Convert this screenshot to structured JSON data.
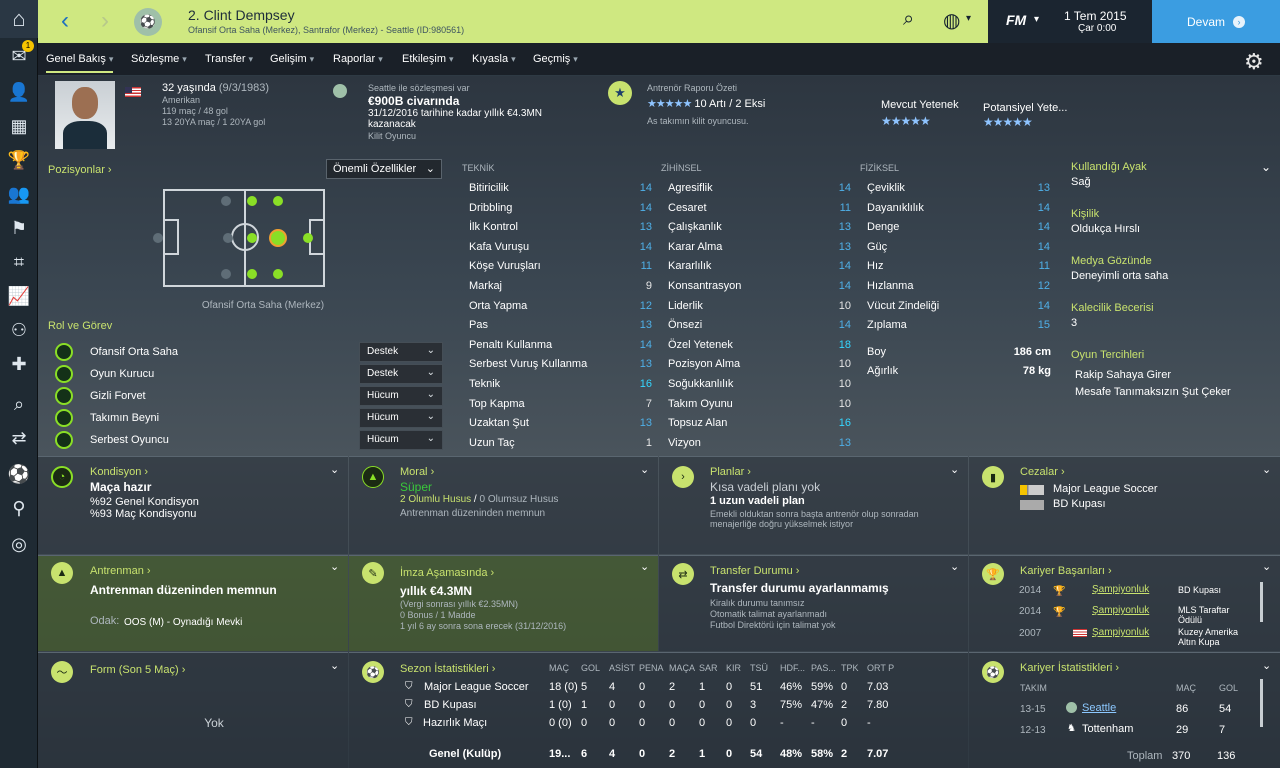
{
  "header": {
    "player_name": "2. Clint Dempsey",
    "player_sub": "Ofansif Orta Saha (Merkez), Santrafor (Merkez) - Seattle (ID:980561)",
    "date_line1": "1 Tem 2015",
    "date_line2": "Çar 0:00",
    "fm_logo": "FM",
    "continue_label": "Devam"
  },
  "sidebar": {
    "badge_count": "1"
  },
  "tabs": [
    {
      "label": "Genel Bakış"
    },
    {
      "label": "Sözleşme"
    },
    {
      "label": "Transfer"
    },
    {
      "label": "Gelişim"
    },
    {
      "label": "Raporlar"
    },
    {
      "label": "Etkileşim"
    },
    {
      "label": "Kıyasla"
    },
    {
      "label": "Geçmiş"
    }
  ],
  "profile": {
    "age": "32 yaşında",
    "dob": "(9/3/1983)",
    "nationality": "Amerikan",
    "club_apps": "119 maç / 48 gol",
    "intl_apps": "13 20YA maç / 1 20YA gol",
    "contract_label": "Seattle ile sözleşmesi var",
    "contract_wage": "€900B civarında",
    "contract_detail1": "31/12/2016 tarihine kadar yıllık €4.3MN",
    "contract_detail2": "kazanacak",
    "contract_role": "Kilit Oyuncu",
    "report_title": "Antrenör Raporu Özeti",
    "report_summary": "10 Artı / 2 Eksi",
    "report_note": "As takımın kilit oyuncusu.",
    "current_ability_label": "Mevcut Yetenek",
    "potential_ability_label": "Potansiyel Yete...",
    "current_ability_stars": 4.5,
    "potential_ability_stars": 4.5
  },
  "positions": {
    "title": "Pozisyonlar",
    "dropdown": "Önemli Özellikler",
    "caption": "Ofansif Orta Saha (Merkez)",
    "roles_title": "Rol ve Görev",
    "roles": [
      {
        "name": "Ofansif Orta Saha",
        "duty": "Destek"
      },
      {
        "name": "Oyun Kurucu",
        "duty": "Destek"
      },
      {
        "name": "Gizli Forvet",
        "duty": "Hücum"
      },
      {
        "name": "Takımın Beyni",
        "duty": "Hücum"
      },
      {
        "name": "Serbest Oyuncu",
        "duty": "Hücum"
      }
    ]
  },
  "attributes": {
    "technical_title": "TEKNİK",
    "mental_title": "ZİHİNSEL",
    "physical_title": "FİZİKSEL",
    "technical": [
      {
        "name": "Bitiricilik",
        "value": "14"
      },
      {
        "name": "Dribbling",
        "value": "14"
      },
      {
        "name": "İlk Kontrol",
        "value": "13"
      },
      {
        "name": "Kafa Vuruşu",
        "value": "14"
      },
      {
        "name": "Köşe Vuruşları",
        "value": "11"
      },
      {
        "name": "Markaj",
        "value": "9"
      },
      {
        "name": "Orta Yapma",
        "value": "12"
      },
      {
        "name": "Pas",
        "value": "13"
      },
      {
        "name": "Penaltı Kullanma",
        "value": "14"
      },
      {
        "name": "Serbest Vuruş Kullanma",
        "value": "13"
      },
      {
        "name": "Teknik",
        "value": "16"
      },
      {
        "name": "Top Kapma",
        "value": "7"
      },
      {
        "name": "Uzaktan Şut",
        "value": "13"
      },
      {
        "name": "Uzun Taç",
        "value": "1"
      }
    ],
    "mental": [
      {
        "name": "Agresiflik",
        "value": "14"
      },
      {
        "name": "Cesaret",
        "value": "11"
      },
      {
        "name": "Çalışkanlık",
        "value": "13"
      },
      {
        "name": "Karar Alma",
        "value": "13"
      },
      {
        "name": "Kararlılık",
        "value": "14"
      },
      {
        "name": "Konsantrasyon",
        "value": "14"
      },
      {
        "name": "Liderlik",
        "value": "10"
      },
      {
        "name": "Önsezi",
        "value": "14"
      },
      {
        "name": "Özel Yetenek",
        "value": "18"
      },
      {
        "name": "Pozisyon Alma",
        "value": "10"
      },
      {
        "name": "Soğukkanlılık",
        "value": "10"
      },
      {
        "name": "Takım Oyunu",
        "value": "10"
      },
      {
        "name": "Topsuz Alan",
        "value": "16"
      },
      {
        "name": "Vizyon",
        "value": "13"
      }
    ],
    "physical": [
      {
        "name": "Çeviklik",
        "value": "13"
      },
      {
        "name": "Dayanıklılık",
        "value": "14"
      },
      {
        "name": "Denge",
        "value": "14"
      },
      {
        "name": "Güç",
        "value": "14"
      },
      {
        "name": "Hız",
        "value": "11"
      },
      {
        "name": "Hızlanma",
        "value": "12"
      },
      {
        "name": "Vücut Zindeliği",
        "value": "14"
      },
      {
        "name": "Zıplama",
        "value": "15"
      }
    ],
    "height_label": "Boy",
    "height": "186 cm",
    "weight_label": "Ağırlık",
    "weight": "78 kg"
  },
  "info": {
    "foot_title": "Kullandığı Ayak",
    "foot": "Sağ",
    "personality_title": "Kişilik",
    "personality": "Oldukça Hırslı",
    "media_title": "Medya Gözünde",
    "media": "Deneyimli orta saha",
    "gk_title": "Kalecilik Becerisi",
    "gk": "3",
    "prefs_title": "Oyun Tercihleri",
    "pref1": "Rakip Sahaya Girer",
    "pref2": "Mesafe Tanımaksızın Şut Çeker"
  },
  "cards": {
    "condition": {
      "title": "Kondisyon",
      "main": "Maça hazır",
      "l1": "%92 Genel Kondisyon",
      "l2": "%93 Maç Kondisyonu"
    },
    "morale": {
      "title": "Moral",
      "main": "Süper",
      "pos": "2 Olumlu Husus",
      "sep": "/",
      "neg": "0 Olumsuz Husus",
      "note": "Antrenman düzeninden memnun"
    },
    "plans": {
      "title": "Planlar",
      "short": "Kısa vadeli planı yok",
      "long": "1 uzun vadeli plan",
      "note": "Emekli olduktan sonra başta antrenör olup sonradan menajerliğe doğru yükselmek istiyor"
    },
    "bans": {
      "title": "Cezalar",
      "b1": "Major League Soccer",
      "b2": "BD Kupası"
    },
    "training": {
      "title": "Antrenman",
      "main": "Antrenman düzeninden memnun",
      "focus_label": "Odak:",
      "focus": "OOS (M) - Oynadığı Mevki"
    },
    "signing": {
      "title": "İmza Aşamasında",
      "main": "yıllık €4.3MN",
      "l1": "(Vergi sonrası yıllık €2.35MN)",
      "l2": "0 Bonus / 1 Madde",
      "l3": "1 yıl 6 ay sonra sona erecek  (31/12/2016)"
    },
    "transfer": {
      "title": "Transfer Durumu",
      "main": "Transfer durumu ayarlanmamış",
      "l1": "Kiralık durumu tanımsız",
      "l2": "Otomatik talimat ayarlanmadı",
      "l3": "Futbol Direktörü için talimat yok"
    },
    "honours": {
      "title": "Kariyer Başarıları",
      "rows": [
        {
          "year": "2014",
          "label": "Şampiyonluk",
          "comp": "BD Kupası"
        },
        {
          "year": "2014",
          "label": "Şampiyonluk",
          "comp": "MLS Taraftar Ödülü"
        },
        {
          "year": "2007",
          "label": "Şampiyonluk",
          "comp": "Kuzey Amerika Altın Kupa"
        }
      ]
    },
    "form": {
      "title": "Form (Son 5 Maç)",
      "value": "Yok"
    },
    "season": {
      "title": "Sezon İstatistikleri",
      "headers": [
        "MAÇ",
        "GOL",
        "ASİST",
        "PENA",
        "MAÇA",
        "SAR",
        "KIR",
        "TSÜ",
        "HDF...",
        "PAS...",
        "TPK",
        "ORT P"
      ],
      "rows": [
        {
          "comp": "Major League Soccer",
          "vals": [
            "18 (0)",
            "5",
            "4",
            "0",
            "2",
            "1",
            "0",
            "51",
            "46%",
            "59%",
            "0",
            "7.03"
          ]
        },
        {
          "comp": "BD Kupası",
          "vals": [
            "1 (0)",
            "1",
            "0",
            "0",
            "0",
            "0",
            "0",
            "3",
            "75%",
            "47%",
            "2",
            "7.80"
          ]
        },
        {
          "comp": "Hazırlık Maçı",
          "vals": [
            "0 (0)",
            "0",
            "0",
            "0",
            "0",
            "0",
            "0",
            "0",
            "-",
            "-",
            "0",
            "-"
          ]
        }
      ],
      "total": {
        "comp": "Genel (Kulüp)",
        "vals": [
          "19...",
          "6",
          "4",
          "0",
          "2",
          "1",
          "0",
          "54",
          "48%",
          "58%",
          "2",
          "7.07"
        ]
      }
    },
    "career": {
      "title": "Kariyer İstatistikleri",
      "h_team": "TAKIM",
      "h_apps": "MAÇ",
      "h_goals": "GOL",
      "rows": [
        {
          "years": "13-15",
          "team": "Seattle",
          "apps": "86",
          "goals": "54"
        },
        {
          "years": "12-13",
          "team": "Tottenham",
          "apps": "29",
          "goals": "7"
        }
      ],
      "total_label": "Toplam",
      "total_apps": "370",
      "total_goals": "136"
    }
  }
}
